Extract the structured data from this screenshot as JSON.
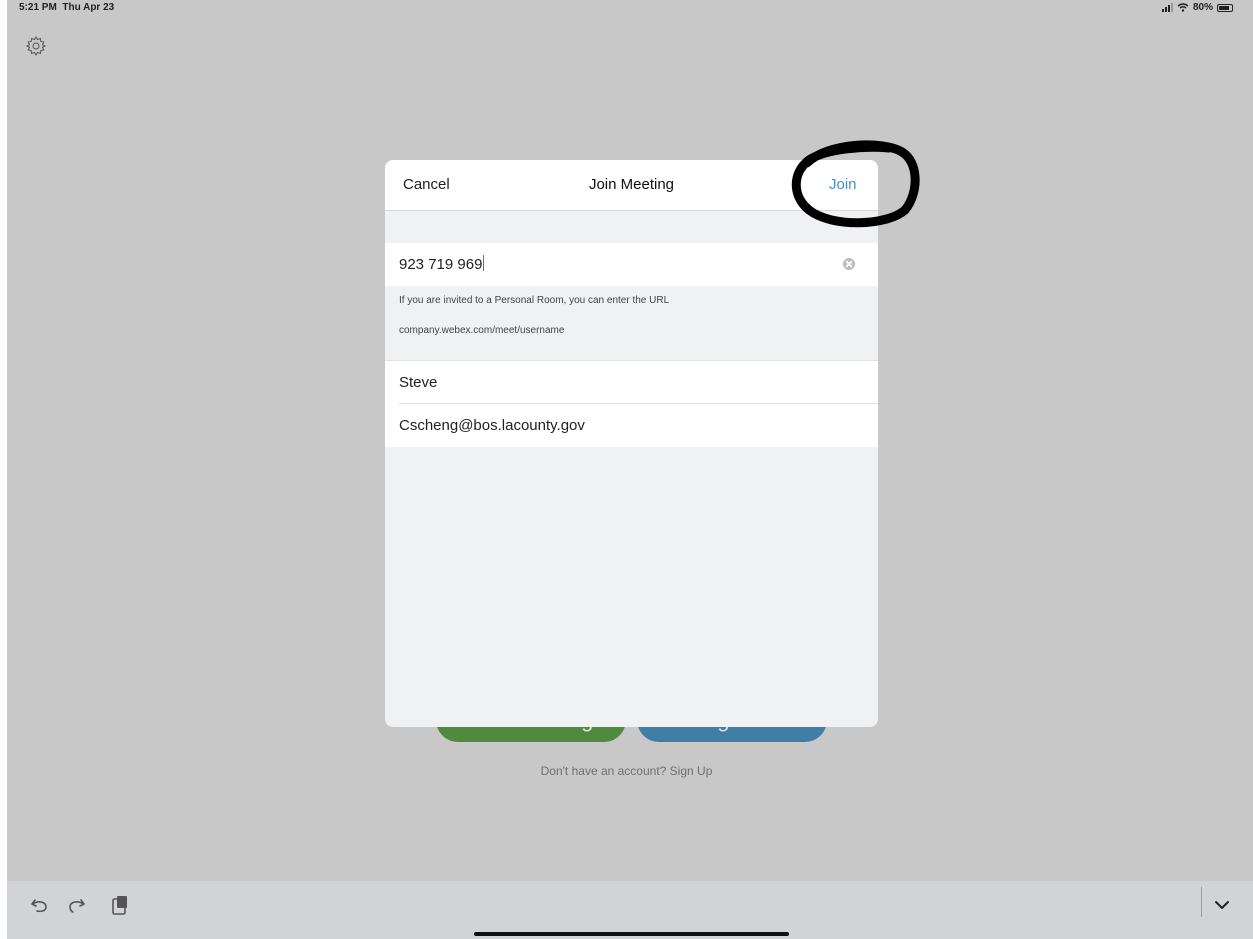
{
  "status_bar": {
    "time": "5:21 PM",
    "date": "Thu Apr 23",
    "battery": "80%",
    "icons": [
      "signal-icon",
      "wifi-icon",
      "battery-icon"
    ]
  },
  "background": {
    "settings_icon": "gear-icon",
    "join_meeting_label": "Join Meeting",
    "sign_in_label": "Sign In",
    "signup_prompt": "Don't have an account? Sign Up",
    "colors": {
      "join": "#4f8a3e",
      "sign_in": "#3f7fa6"
    }
  },
  "modal": {
    "title": "Join Meeting",
    "cancel_label": "Cancel",
    "join_label": "Join",
    "meeting_number": "923 719 969",
    "hint_line1": "If you are invited to a Personal Room, you can enter the URL",
    "hint_line2": "company.webex.com/meet/username",
    "name": "Steve",
    "email": "Cscheng@bos.lacounty.gov",
    "annotation": "hand-drawn-circle-around-join",
    "accent_color": "#4a90c0"
  },
  "keyboard_toolbar": {
    "icons": [
      "undo-icon",
      "redo-icon",
      "paste-icon",
      "chevron-down-icon"
    ]
  }
}
